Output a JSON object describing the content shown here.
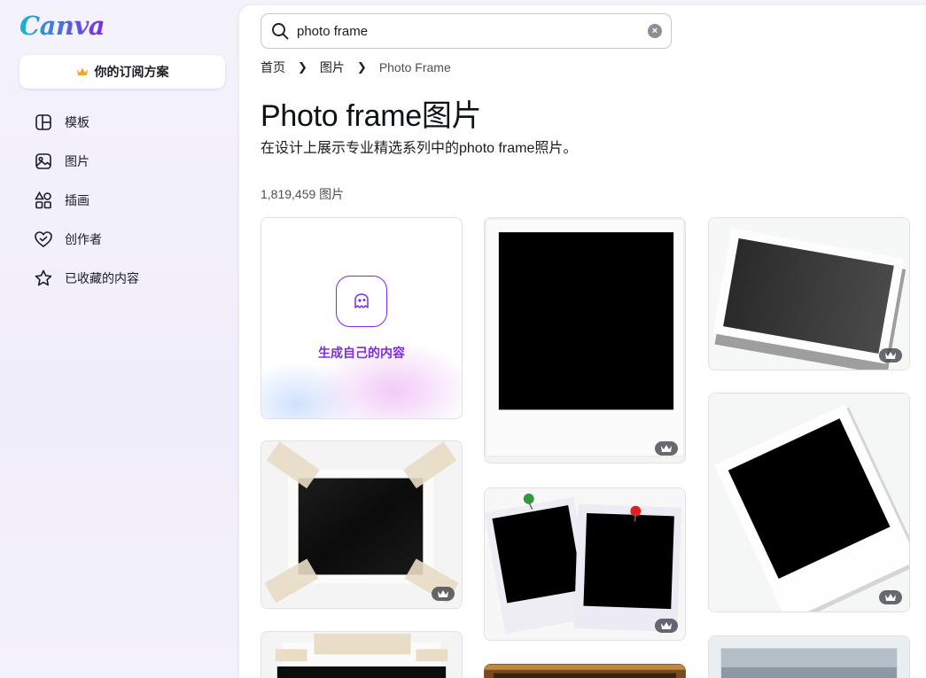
{
  "brand": {
    "logo_text": "Canva"
  },
  "sidebar": {
    "plan_label": "你的订阅方案",
    "items": [
      {
        "label": "模板",
        "icon": "template-icon"
      },
      {
        "label": "图片",
        "icon": "image-icon"
      },
      {
        "label": "插画",
        "icon": "shapes-icon"
      },
      {
        "label": "创作者",
        "icon": "heart-creator-icon"
      },
      {
        "label": "已收藏的内容",
        "icon": "star-icon"
      }
    ]
  },
  "search": {
    "value": "photo frame",
    "icon": "search-icon",
    "clear_icon": "clear-icon"
  },
  "breadcrumb": {
    "items": [
      "首页",
      "图片",
      "Photo Frame"
    ]
  },
  "page": {
    "title": "Photo frame图片",
    "subtitle": "在设计上展示专业精选系列中的photo frame照片。",
    "result_count": "1,819,459 图片"
  },
  "generate_card": {
    "label": "生成自己的内容",
    "icon": "magic-generate-icon"
  },
  "results": [
    {
      "name": "white-polaroid-frame",
      "pro": true
    },
    {
      "name": "tilted-photo-frame-shadow",
      "pro": true
    },
    {
      "name": "taped-black-photo",
      "pro": true
    },
    {
      "name": "pinned-polaroids",
      "pro": true
    },
    {
      "name": "rotated-polaroid",
      "pro": true
    },
    {
      "name": "taped-frame-partial",
      "pro": false
    },
    {
      "name": "gold-frame-partial",
      "pro": false
    },
    {
      "name": "landscape-frame-partial",
      "pro": false
    }
  ],
  "colors": {
    "accent": "#7d2ae8",
    "crown": "#f5a623",
    "badge": "#46484f"
  }
}
